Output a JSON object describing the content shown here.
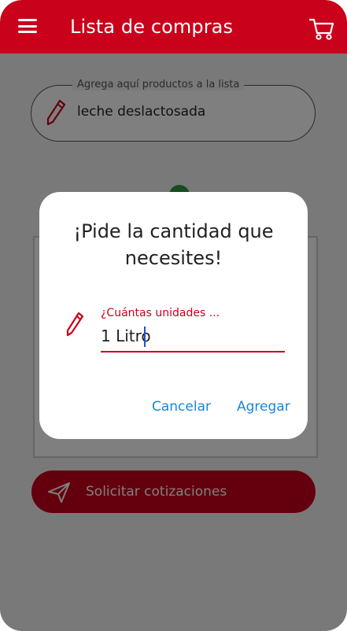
{
  "header": {
    "title": "Lista de compras",
    "menu_icon": "hamburger-menu-icon",
    "cart_icon": "shopping-cart-icon",
    "color": "#c9011b"
  },
  "add_product": {
    "label": "Agrega aquí productos a la lista",
    "value": "leche deslactosada",
    "icon": "pencil-icon"
  },
  "quote_button": {
    "label": "Solicitar cotizaciones",
    "icon": "send-icon"
  },
  "dialog": {
    "title": "¡Pide la cantidad que necesites!",
    "quantity_field": {
      "label": "¿Cuántas unidades ...",
      "value": "1 Litro",
      "icon": "pencil-icon"
    },
    "cancel_label": "Cancelar",
    "confirm_label": "Agregar",
    "accent": "#c9011b",
    "button_color": "#1a86d9"
  }
}
